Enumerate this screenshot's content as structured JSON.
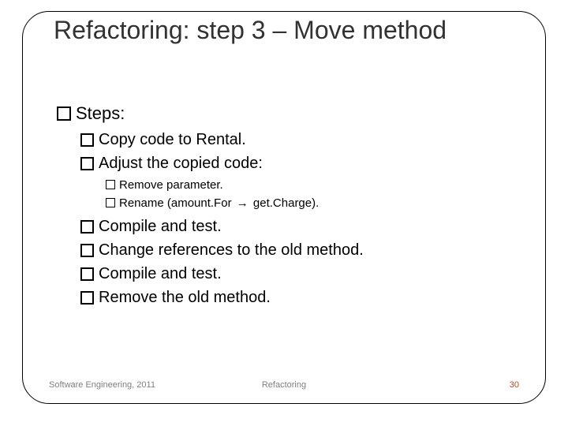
{
  "title": "Refactoring: step 3 – Move method",
  "steps_label": "Steps:",
  "l2": {
    "copy": "Copy code to Rental.",
    "adjust": "Adjust the copied code:",
    "compile1_pre": " ",
    "compile1": "Compile and test.",
    "change": "Change references to the old method.",
    "compile2": "Compile and test.",
    "remove": "Remove the old method."
  },
  "l3": {
    "remove_param": "Remove parameter.",
    "rename_a": "Rename (amount.For ",
    "rename_b": " get.Charge)."
  },
  "arrow": "→",
  "footer": {
    "left": "Software Engineering, 2011",
    "center": "Refactoring",
    "right": "30"
  }
}
